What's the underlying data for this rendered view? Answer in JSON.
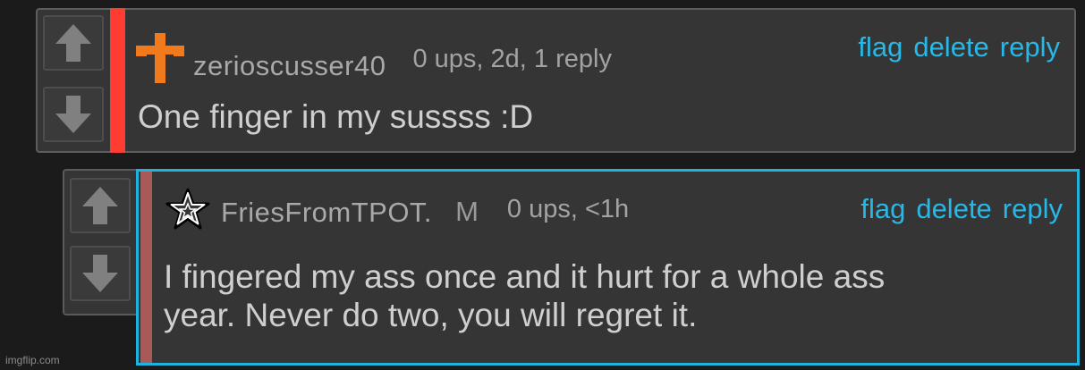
{
  "comments": [
    {
      "username": "zerioscusser40",
      "meta": "0 ups, 2d, 1 reply",
      "text_lines": [
        "One finger in my sussss :D"
      ],
      "actions": {
        "flag": "flag",
        "delete": "delete",
        "reply": "reply"
      },
      "accent_color": "#ff3c32",
      "avatar_icon": "cross-icon"
    },
    {
      "username": "FriesFromTPOT.",
      "badge": "M",
      "meta": "0 ups, <1h",
      "text_lines": [
        "I fingered my ass once and it hurt for a whole ass",
        "year. Never do two, you will regret it."
      ],
      "actions": {
        "flag": "flag",
        "delete": "delete",
        "reply": "reply"
      },
      "accent_color": "#a85a58",
      "highlight_color": "#1fb4e0",
      "avatar_icon": "star-icon"
    }
  ],
  "watermark": "imgflip.com"
}
